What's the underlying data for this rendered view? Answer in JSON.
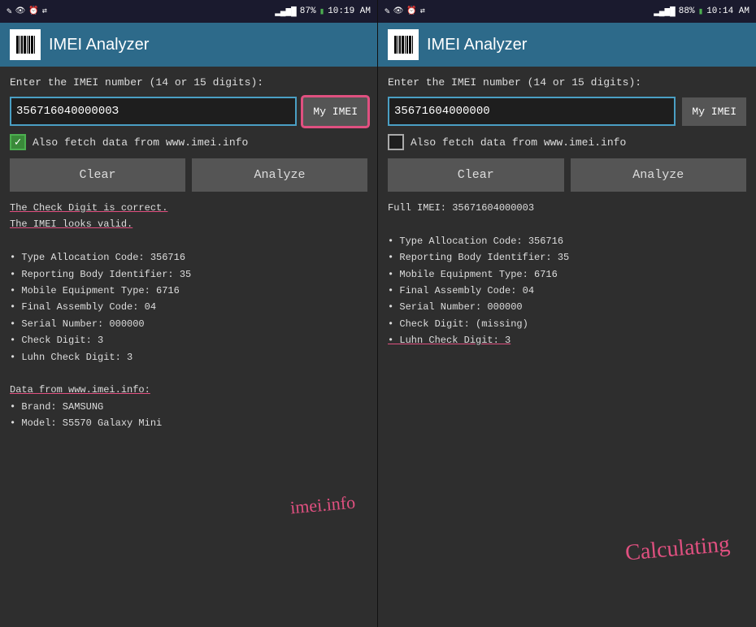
{
  "panels": [
    {
      "id": "left",
      "status_bar": {
        "left_icon": "✎",
        "signal": "📶",
        "battery_pct": "87%",
        "time": "10:19 AM",
        "extra_icons": [
          "👁",
          "⏰",
          "⇄"
        ]
      },
      "header": {
        "title": "IMEI Analyzer"
      },
      "body": {
        "input_label": "Enter the IMEI number (14 or 15 digits):",
        "input_value": "35671604000000З",
        "my_imei_label": "My IMEI",
        "my_imei_circled": true,
        "checkbox_checked": true,
        "checkbox_label": "Also fetch data from www.imei.info",
        "clear_label": "Clear",
        "analyze_label": "Analyze",
        "results": [
          {
            "text": "The Check Digit is correct.",
            "underlined": true
          },
          {
            "text": "The IMEI looks valid.",
            "underlined": true
          },
          {
            "text": ""
          },
          {
            "text": "• Type Allocation Code: 356716"
          },
          {
            "text": "• Reporting Body Identifier: 35"
          },
          {
            "text": "• Mobile Equipment Type: 6716"
          },
          {
            "text": "• Final Assembly Code: 04"
          },
          {
            "text": "• Serial Number: 000000"
          },
          {
            "text": "• Check Digit: 3"
          },
          {
            "text": "• Luhn Check Digit: 3"
          },
          {
            "text": ""
          },
          {
            "text": "Data from www.imei.info:",
            "is_section_header": true
          },
          {
            "text": "• Brand: SAMSUNG"
          },
          {
            "text": "• Model: S5570 Galaxy Mini"
          }
        ],
        "annotation": "imei.info"
      }
    },
    {
      "id": "right",
      "status_bar": {
        "left_icon": "✎",
        "signal": "📶",
        "battery_pct": "88%",
        "time": "10:14 AM",
        "extra_icons": [
          "👁",
          "⏰",
          "⇄"
        ]
      },
      "header": {
        "title": "IMEI Analyzer"
      },
      "body": {
        "input_label": "Enter the IMEI number (14 or 15 digits):",
        "input_value": "35671604000000",
        "my_imei_label": "My IMEI",
        "my_imei_circled": false,
        "checkbox_checked": false,
        "checkbox_label": "Also fetch data from www.imei.info",
        "clear_label": "Clear",
        "analyze_label": "Analyze",
        "results": [
          {
            "text": "Full IMEI: 35671604000003"
          },
          {
            "text": ""
          },
          {
            "text": "• Type Allocation Code: 356716"
          },
          {
            "text": "• Reporting Body Identifier: 35"
          },
          {
            "text": "• Mobile Equipment Type: 6716"
          },
          {
            "text": "• Final Assembly Code: 04"
          },
          {
            "text": "• Serial Number: 000000"
          },
          {
            "text": "• Check Digit: (missing)"
          },
          {
            "text": "• Luhn Check Digit: 3",
            "underlined": true
          }
        ],
        "annotation": "Calculating"
      }
    }
  ]
}
